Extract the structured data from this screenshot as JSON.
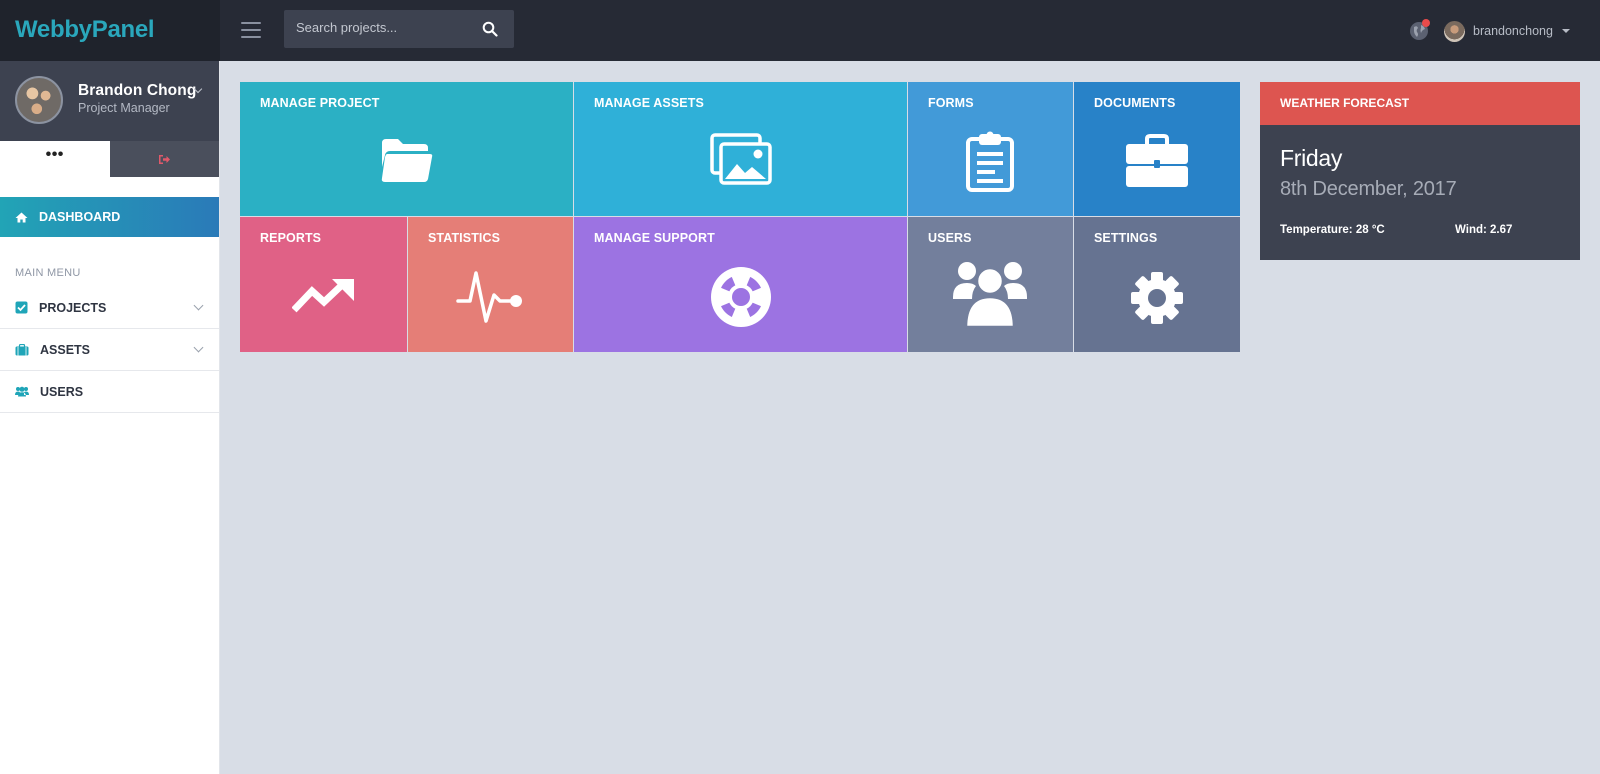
{
  "app": {
    "brand": "WebbyPanel"
  },
  "header": {
    "search_placeholder": "Search projects...",
    "username": "brandonchong"
  },
  "profile": {
    "name": "Brandon Chong",
    "role": "Project Manager"
  },
  "sidebar": {
    "tab_dots": "•••",
    "dashboard_label": "DASHBOARD",
    "menu_heading": "MAIN MENU",
    "items": [
      {
        "label": "PROJECTS",
        "icon": "check-square-icon"
      },
      {
        "label": "ASSETS",
        "icon": "briefcase-icon"
      },
      {
        "label": "USERS",
        "icon": "users-icon"
      }
    ]
  },
  "tiles": [
    {
      "label": "MANAGE PROJECT",
      "color": "#2bb0c4",
      "icon": "folder-icon"
    },
    {
      "label": "MANAGE ASSETS",
      "color": "#2fb0d8",
      "icon": "images-icon"
    },
    {
      "label": "FORMS",
      "color": "#429ad8",
      "icon": "clipboard-icon"
    },
    {
      "label": "DOCUMENTS",
      "color": "#2882c8",
      "icon": "briefcase-icon"
    },
    {
      "label": "REPORTS",
      "color": "#e06186",
      "icon": "trend-up-icon"
    },
    {
      "label": "STATISTICS",
      "color": "#e57e77",
      "icon": "pulse-icon"
    },
    {
      "label": "MANAGE SUPPORT",
      "color": "#9c73e2",
      "icon": "life-ring-icon"
    },
    {
      "label": "USERS",
      "color": "#737f9c",
      "icon": "users-icon"
    },
    {
      "label": "SETTINGS",
      "color": "#667391",
      "icon": "gear-icon"
    }
  ],
  "weather": {
    "title": "WEATHER FORECAST",
    "day": "Friday",
    "date": "8th December, 2017",
    "temperature": "Temperature: 28 °C",
    "wind": "Wind: 2.67"
  }
}
